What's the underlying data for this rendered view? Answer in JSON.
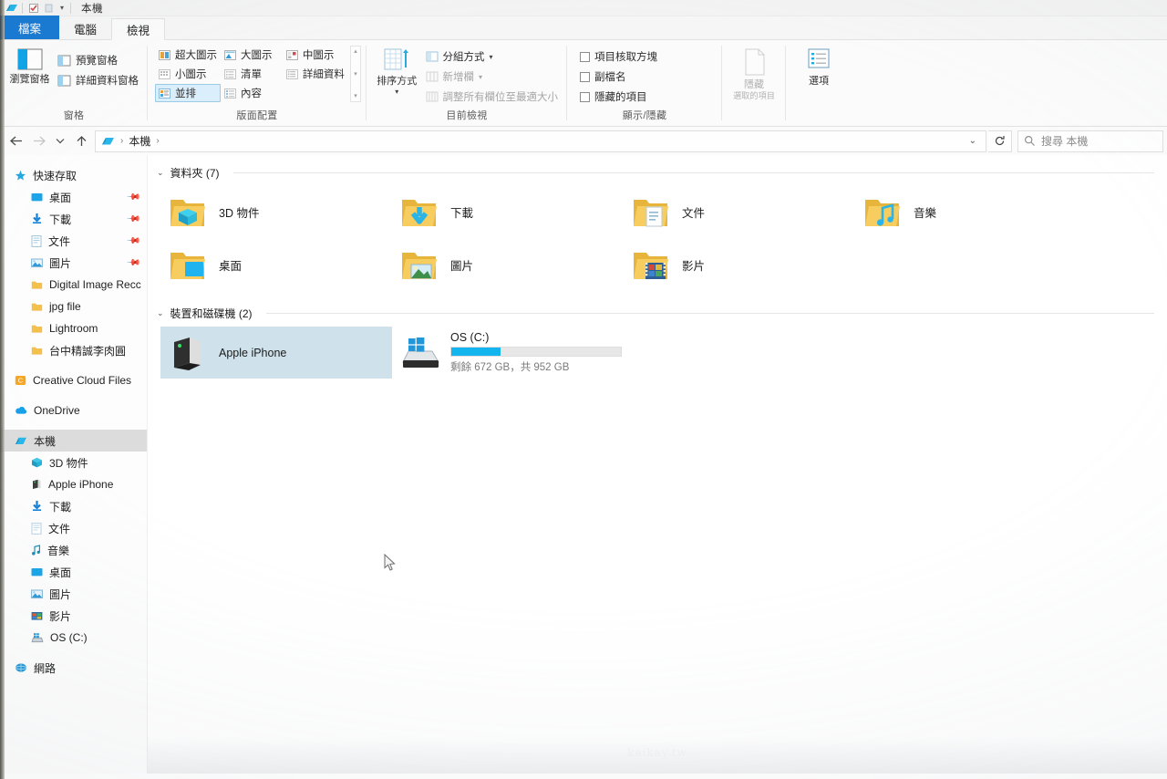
{
  "window": {
    "title": "本機",
    "quick_access_icons": [
      "explorer-icon",
      "properties-icon",
      "new-folder-icon"
    ],
    "customize_chevron": "▾"
  },
  "tabs": [
    {
      "id": "file",
      "label": "檔案"
    },
    {
      "id": "computer",
      "label": "電腦"
    },
    {
      "id": "view",
      "label": "檢視"
    }
  ],
  "ribbon": {
    "groups": [
      {
        "name": "panes",
        "label": "窗格",
        "big_button": {
          "label_top": "瀏覽窗格",
          "icon": "navigation-pane-icon"
        },
        "items": [
          {
            "label": "預覽窗格",
            "icon": "preview-pane-icon",
            "state": "normal"
          },
          {
            "label": "詳細資料窗格",
            "icon": "details-pane-icon",
            "state": "normal"
          }
        ]
      },
      {
        "name": "layout",
        "label": "版面配置",
        "gallery": [
          {
            "label": "超大圖示",
            "icon": "extra-large-icons-icon",
            "selected": false
          },
          {
            "label": "大圖示",
            "icon": "large-icons-icon",
            "selected": false
          },
          {
            "label": "中圖示",
            "icon": "medium-icons-icon",
            "selected": false
          },
          {
            "label": "小圖示",
            "icon": "small-icons-icon",
            "selected": false
          },
          {
            "label": "清單",
            "icon": "list-icon",
            "selected": false
          },
          {
            "label": "詳細資料",
            "icon": "details-icon",
            "selected": false
          },
          {
            "label": "並排",
            "icon": "tiles-icon",
            "selected": true
          },
          {
            "label": "內容",
            "icon": "content-icon",
            "selected": false
          }
        ],
        "scroll_up": "▴",
        "scroll_down": "▾",
        "scroll_more": "▾"
      },
      {
        "name": "current-view",
        "label": "目前檢視",
        "big_button": {
          "label_top": "排序方式",
          "icon": "sort-by-icon",
          "has_dropdown": true
        },
        "items": [
          {
            "label": "分組方式",
            "icon": "group-by-icon",
            "state": "normal",
            "has_dropdown": true
          },
          {
            "label": "新增欄",
            "icon": "add-columns-icon",
            "state": "dim",
            "has_dropdown": true
          },
          {
            "label": "調整所有欄位至最適大小",
            "icon": "size-all-columns-icon",
            "state": "dim"
          }
        ]
      },
      {
        "name": "show-hide",
        "label": "顯示/隱藏",
        "checkboxes": [
          {
            "label": "項目核取方塊",
            "checked": false
          },
          {
            "label": "副檔名",
            "checked": false
          },
          {
            "label": "隱藏的項目",
            "checked": false
          }
        ],
        "buttons": [
          {
            "label_top": "隱藏",
            "label_bottom": "選取的項目",
            "icon": "hide-selected-icon",
            "state": "dim"
          },
          {
            "label_top": "選項",
            "icon": "options-icon",
            "state": "normal",
            "has_dropdown": false
          }
        ]
      }
    ]
  },
  "addressbar": {
    "back_icon": "arrow-left-icon",
    "forward_icon": "arrow-right-icon",
    "recent_icon": "chevron-down-icon",
    "up_icon": "arrow-up-icon",
    "crumb_icon": "this-pc-icon",
    "breadcrumbs": [
      "本機"
    ],
    "separator": "›",
    "dropdown": "⌄",
    "refresh_icon": "refresh-icon",
    "search": {
      "icon": "search-icon",
      "placeholder": "搜尋 本機",
      "value": ""
    }
  },
  "sidebar": {
    "sections": [
      {
        "name": "quick-access",
        "label": "快速存取",
        "icon": "star-icon",
        "items": [
          {
            "label": "桌面",
            "icon": "desktop-icon",
            "pinned": true
          },
          {
            "label": "下載",
            "icon": "downloads-icon",
            "pinned": true
          },
          {
            "label": "文件",
            "icon": "documents-icon",
            "pinned": true
          },
          {
            "label": "圖片",
            "icon": "pictures-icon",
            "pinned": true
          },
          {
            "label": "Digital Image Recc",
            "icon": "folder-icon",
            "pinned": false
          },
          {
            "label": "jpg file",
            "icon": "folder-icon",
            "pinned": false
          },
          {
            "label": "Lightroom",
            "icon": "folder-icon",
            "pinned": false
          },
          {
            "label": "台中精誠李肉圓",
            "icon": "folder-icon",
            "pinned": false
          }
        ]
      },
      {
        "name": "creative-cloud",
        "label": "Creative Cloud Files",
        "icon": "creative-cloud-icon",
        "items": []
      },
      {
        "name": "onedrive",
        "label": "OneDrive",
        "icon": "onedrive-icon",
        "items": []
      },
      {
        "name": "this-pc",
        "label": "本機",
        "icon": "this-pc-icon",
        "selected": true,
        "items": [
          {
            "label": "3D 物件",
            "icon": "3d-objects-icon"
          },
          {
            "label": "Apple iPhone",
            "icon": "phone-device-icon"
          },
          {
            "label": "下載",
            "icon": "downloads-icon"
          },
          {
            "label": "文件",
            "icon": "documents-icon"
          },
          {
            "label": "音樂",
            "icon": "music-icon"
          },
          {
            "label": "桌面",
            "icon": "desktop-icon"
          },
          {
            "label": "圖片",
            "icon": "pictures-icon"
          },
          {
            "label": "影片",
            "icon": "videos-icon"
          },
          {
            "label": "OS (C:)",
            "icon": "disk-drive-icon"
          }
        ]
      },
      {
        "name": "network",
        "label": "網路",
        "icon": "network-icon",
        "items": []
      }
    ]
  },
  "content": {
    "groups": [
      {
        "name": "folders",
        "header": "資料夾 (7)",
        "collapse_icon": "chevron-down-icon",
        "items": [
          {
            "name": "3D 物件",
            "icon": "folder-3d-objects-icon",
            "selected": false
          },
          {
            "name": "下載",
            "icon": "folder-downloads-icon",
            "selected": false
          },
          {
            "name": "文件",
            "icon": "folder-documents-icon",
            "selected": false
          },
          {
            "name": "音樂",
            "icon": "folder-music-icon",
            "selected": false
          },
          {
            "name": "桌面",
            "icon": "folder-desktop-icon",
            "selected": false
          },
          {
            "name": "圖片",
            "icon": "folder-pictures-icon",
            "selected": false
          },
          {
            "name": "影片",
            "icon": "folder-videos-icon",
            "selected": false
          }
        ]
      },
      {
        "name": "devices-and-drives",
        "header": "裝置和磁碟機 (2)",
        "collapse_icon": "chevron-down-icon",
        "items": [
          {
            "name": "Apple iPhone",
            "icon": "phone-device-icon",
            "selected": true
          },
          {
            "name": "OS (C:)",
            "icon": "hard-drive-icon",
            "selected": false,
            "capacity_text": "剩餘 672 GB，共 952 GB",
            "free_gb": 672,
            "total_gb": 952,
            "used_percent": 29
          }
        ]
      }
    ]
  },
  "watermark": {
    "line1": "Kai",
    "line2": "kaikay.tw"
  },
  "colors": {
    "accent_blue": "#1a7bd4",
    "selection_blue": "#cfe1ea",
    "drive_bar_fill": "#14b4ef",
    "folder_yellow": "#f6c349",
    "sidebar_selected": "#dcdcdc"
  }
}
